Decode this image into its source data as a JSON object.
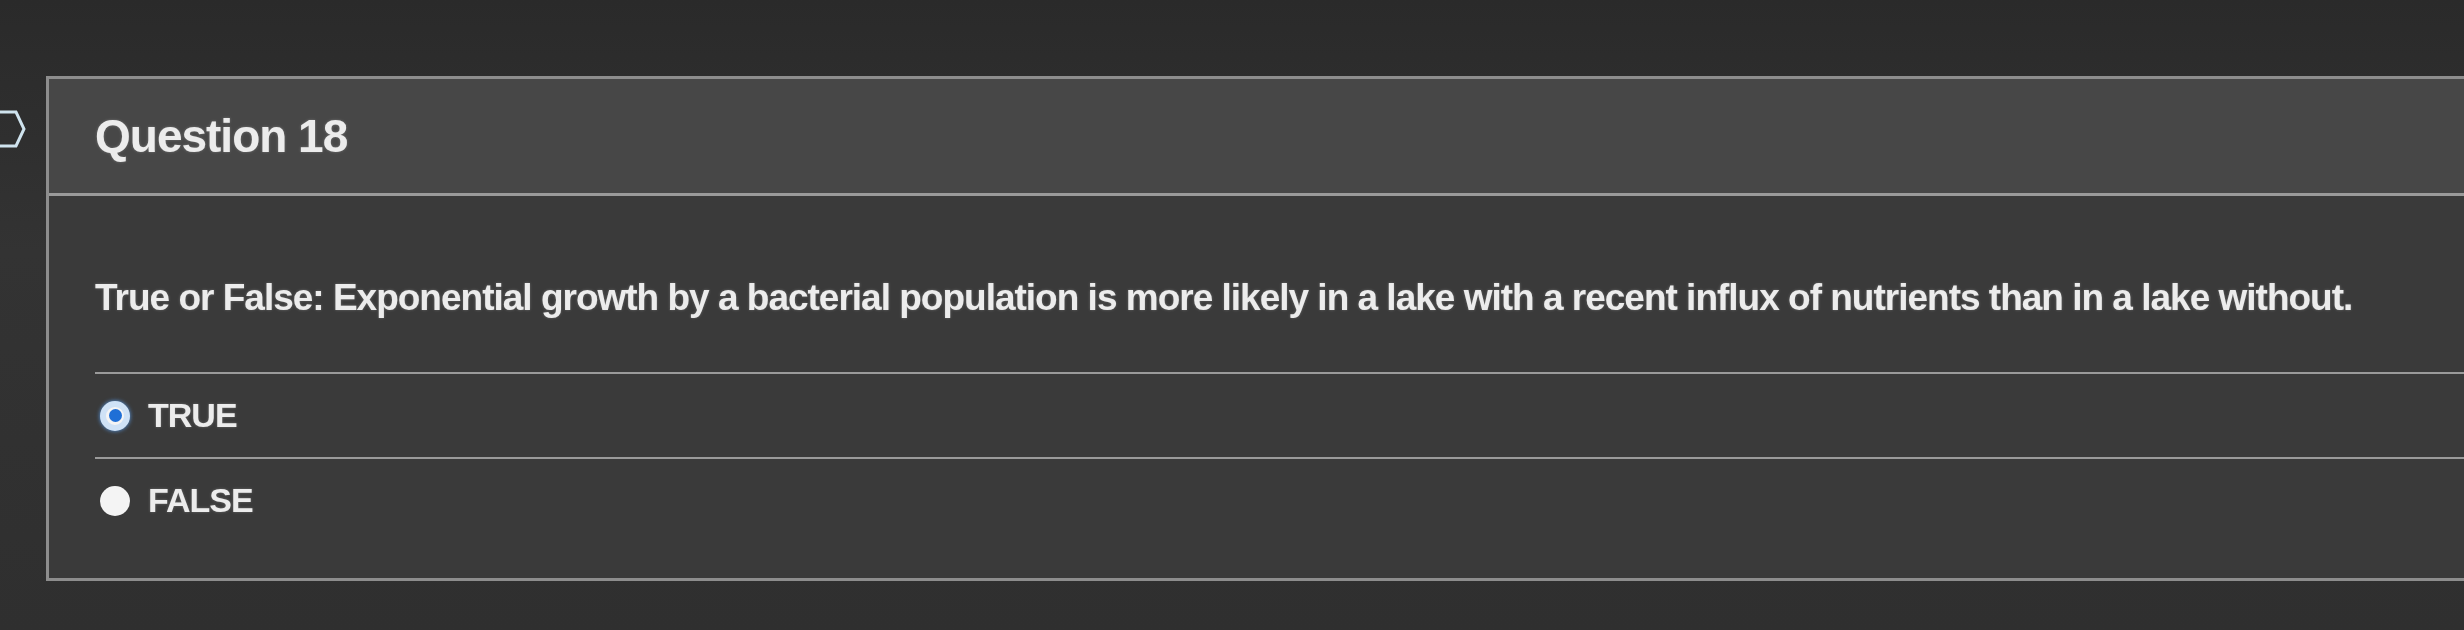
{
  "question": {
    "title": "Question 18",
    "text": "True or False: Exponential growth by a bacterial population is more likely in a lake with a recent influx of nutrients than in a lake without.",
    "options": [
      {
        "label": "TRUE",
        "selected": true
      },
      {
        "label": "FALSE",
        "selected": false
      }
    ]
  }
}
